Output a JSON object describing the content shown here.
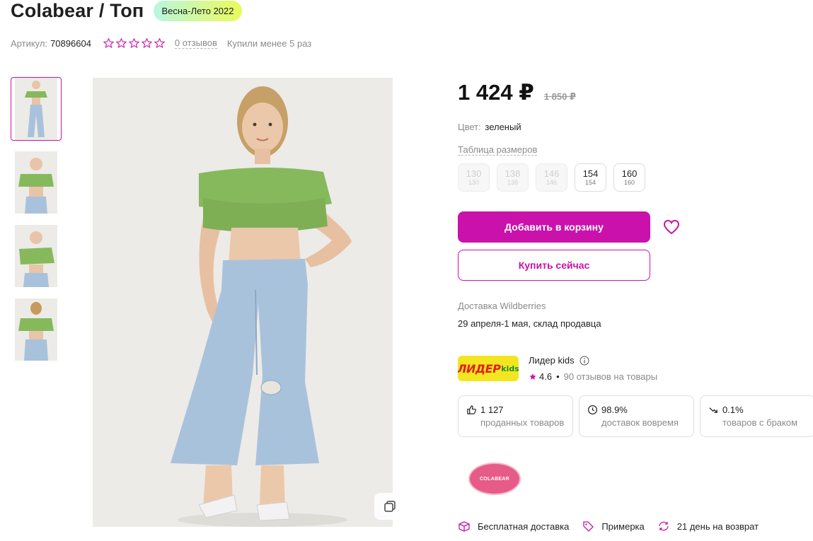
{
  "header": {
    "title": "Colabear / Топ",
    "season_badge": "Весна-Лето 2022"
  },
  "meta": {
    "article_label": "Артикул:",
    "article_value": "70896604",
    "rating_stars": 0,
    "reviews_link": "0 отзывов",
    "bought_text": "Купили менее 5 раз"
  },
  "gallery": {
    "thumbnail_count": 4,
    "active_index": 0
  },
  "price": {
    "current": "1 424 ₽",
    "old": "1 850 ₽"
  },
  "color": {
    "label": "Цвет:",
    "value": "зеленый"
  },
  "size_table_link": "Таблица размеров",
  "sizes": [
    {
      "main": "130",
      "sub": "130",
      "available": false
    },
    {
      "main": "138",
      "sub": "138",
      "available": false
    },
    {
      "main": "146",
      "sub": "146",
      "available": false
    },
    {
      "main": "154",
      "sub": "154",
      "available": true
    },
    {
      "main": "160",
      "sub": "160",
      "available": true
    }
  ],
  "actions": {
    "add_to_cart": "Добавить в корзину",
    "buy_now": "Купить сейчас"
  },
  "delivery": {
    "label": "Доставка Wildberries",
    "date": "29 апреля-1 мая, склад продавца"
  },
  "seller": {
    "logo_word": "ЛИДЕР",
    "logo_kids": "kids",
    "name": "Лидер kids",
    "rating": "4.6",
    "reviews": "90 отзывов на товары"
  },
  "stats": [
    {
      "icon": "thumbs-up-icon",
      "value": "1 127",
      "label": "проданных товаров"
    },
    {
      "icon": "clock-icon",
      "value": "98.9%",
      "label": "доставок вовремя"
    },
    {
      "icon": "trend-down-icon",
      "value": "0.1%",
      "label": "товаров с браком"
    }
  ],
  "brand_logo_text": "COLABEAR",
  "perks": [
    {
      "icon": "delivery-box-icon",
      "label": "Бесплатная доставка"
    },
    {
      "icon": "tag-icon",
      "label": "Примерка"
    },
    {
      "icon": "return-icon",
      "label": "21 день на возврат"
    }
  ],
  "colors": {
    "accent": "#cb11ab",
    "top_green": "#86b95c",
    "jeans_blue": "#a9c2dc"
  }
}
